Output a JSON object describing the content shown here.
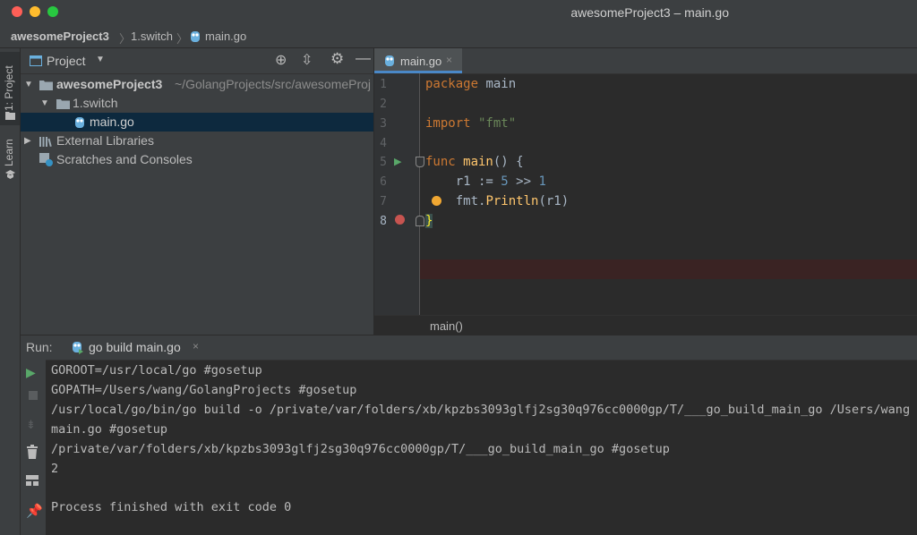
{
  "window": {
    "title": "awesomeProject3 – main.go"
  },
  "breadcrumb": [
    "awesomeProject3",
    "1.switch",
    "main.go"
  ],
  "left_strip": {
    "project_tab": "1: Project",
    "learn_tab": "Learn"
  },
  "project_panel": {
    "title": "Project",
    "tree": [
      {
        "label": "awesomeProject3",
        "path": "~/GolangProjects/src/awesomeProj"
      },
      {
        "label": "1.switch"
      },
      {
        "label": "main.go"
      },
      {
        "label": "External Libraries"
      },
      {
        "label": "Scratches and Consoles"
      }
    ]
  },
  "editor": {
    "tab": "main.go",
    "line_numbers": [
      "1",
      "2",
      "3",
      "4",
      "5",
      "6",
      "7",
      "8"
    ],
    "code": {
      "l1_kw": "package",
      "l1_rest": " main",
      "l3_kw": "import",
      "l3_str": " \"fmt\"",
      "l5_kw": "func",
      "l5_fn": " main",
      "l5_rest": "() {",
      "l6_var": "    r1 := ",
      "l6_num1": "5",
      "l6_op": " >> ",
      "l6_num2": "1",
      "l7_pkg": "    fmt.",
      "l7_fn": "Println",
      "l7_rest": "(r1)",
      "l8": "}"
    },
    "status": "main()"
  },
  "run_panel": {
    "label": "Run:",
    "tab": "go build main.go",
    "console": [
      "GOROOT=/usr/local/go #gosetup",
      "GOPATH=/Users/wang/GolangProjects #gosetup",
      "/usr/local/go/bin/go build -o /private/var/folders/xb/kpzbs3093glfj2sg30q976cc0000gp/T/___go_build_main_go /Users/wang",
      "main.go #gosetup",
      "/private/var/folders/xb/kpzbs3093glfj2sg30q976cc0000gp/T/___go_build_main_go #gosetup",
      "2",
      "",
      "Process finished with exit code 0"
    ]
  },
  "colors": {
    "accent": "#4a88c7",
    "keyword": "#cc7832",
    "function": "#ffc66d",
    "number": "#6897bb",
    "string": "#6a8759",
    "run_green": "#59a869",
    "breakpoint": "#c75450"
  }
}
